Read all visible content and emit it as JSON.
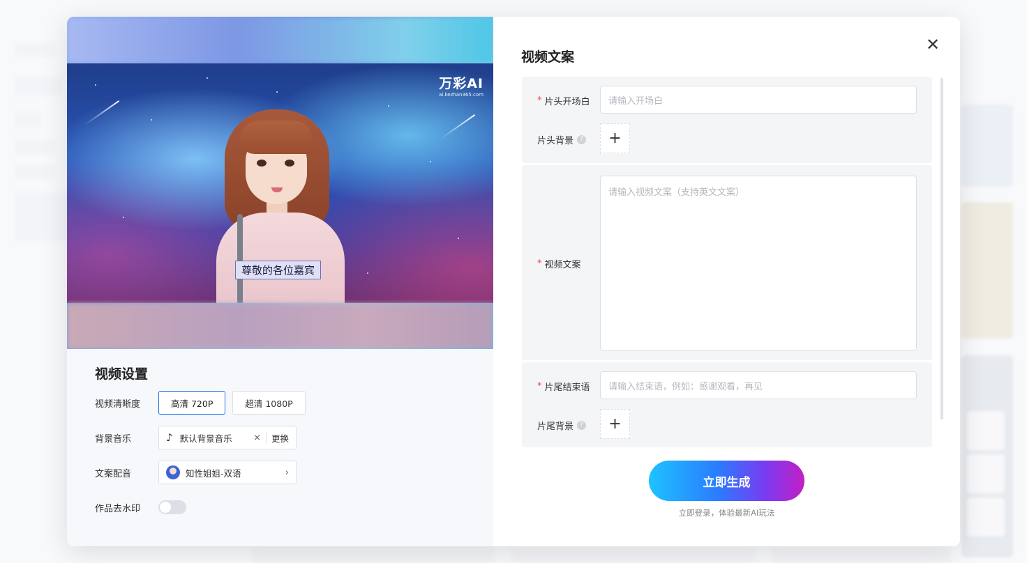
{
  "preview": {
    "logo_main": "万彩AI",
    "logo_sub": "ai.kezhan365.com",
    "subtitle": "尊敬的各位嘉宾"
  },
  "settings": {
    "title": "视频设置",
    "resolution": {
      "label": "视频清晰度",
      "options": [
        "高清 720P",
        "超清 1080P"
      ],
      "selected": "高清 720P"
    },
    "music": {
      "label": "背景音乐",
      "value": "默认背景音乐",
      "clear": "×",
      "change": "更换"
    },
    "voice": {
      "label": "文案配音",
      "value": "知性姐姐-双语"
    },
    "watermark": {
      "label": "作品去水印",
      "enabled": false
    }
  },
  "form": {
    "title": "视频文案",
    "required_mark": "*",
    "opening": {
      "label": "片头开场白",
      "placeholder": "请输入开场白"
    },
    "opening_bg": {
      "label": "片头背景",
      "help": "?"
    },
    "script": {
      "label": "视频文案",
      "placeholder": "请输入视频文案（支持英文文案）"
    },
    "ending": {
      "label": "片尾结束语",
      "placeholder": "请输入结束语，例如：感谢观看，再见"
    },
    "ending_bg": {
      "label": "片尾背景",
      "help": "?"
    },
    "add_symbol": "+",
    "generate_button": "立即生成",
    "hint": "立即登录，体验最新AI玩法"
  },
  "colors": {
    "accent": "#1f6feb",
    "required": "#e5484d",
    "gradient_start": "#1ec2ff",
    "gradient_end": "#c21fc4"
  }
}
